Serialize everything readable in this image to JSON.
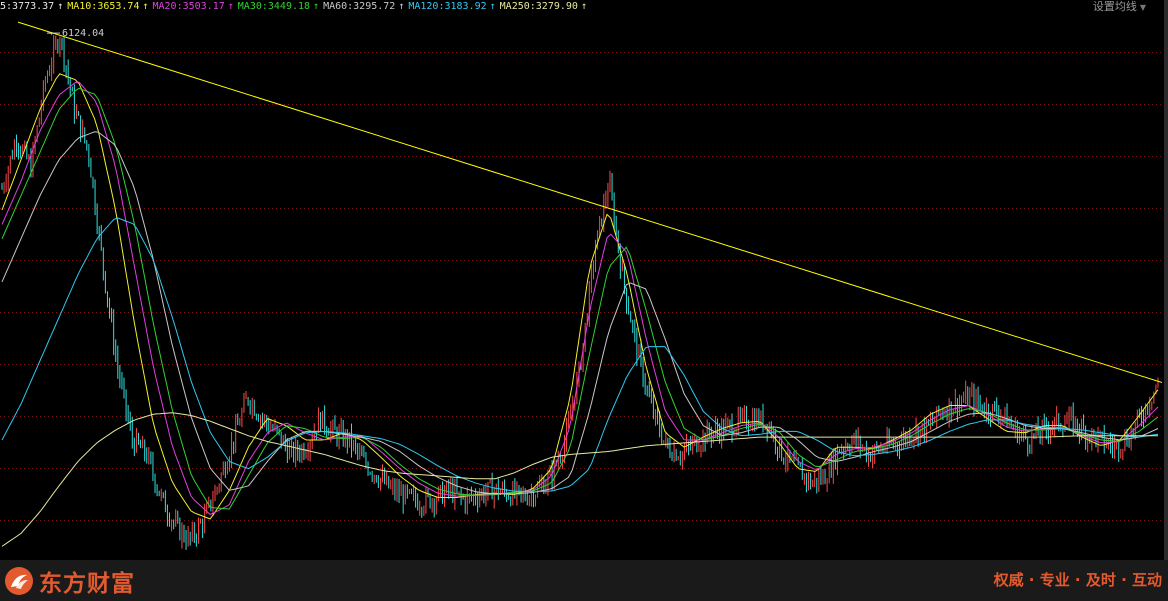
{
  "legend": [
    {
      "text": "5:3773.37",
      "color": "#e8e8e8"
    },
    {
      "text": "MA10:3653.74",
      "color": "#f2f22c"
    },
    {
      "text": "MA20:3503.17",
      "color": "#e040e0"
    },
    {
      "text": "MA30:3449.18",
      "color": "#32d232"
    },
    {
      "text": "MA60:3295.72",
      "color": "#c8c8c8"
    },
    {
      "text": "MA120:3183.92",
      "color": "#30c8f0"
    },
    {
      "text": "MA250:3279.90",
      "color": "#e8e8a0"
    }
  ],
  "legend_arrow": "↑",
  "settings_label": "设置均线",
  "footer": {
    "brand": "东方财富",
    "slogan": "权威 · 专业 · 及时 · 互动"
  },
  "colors": {
    "background": "#000000",
    "gridline": "#7a1515",
    "up_candle": "#ff4a4a",
    "down_candle": "#30e0e0",
    "trendline": "#ffff00",
    "brand": "#e45a2f"
  },
  "chart_data": {
    "type": "line",
    "subtype": "candlestick-with-moving-averages",
    "peak_label": "6124.04",
    "peak_value": 6124.04,
    "price_range": [
      2500,
      6250
    ],
    "grid": true,
    "gridlines": 10,
    "trendline": {
      "description": "descending resistance line through the two major peaks",
      "from_value": 6124.04,
      "to_value": 3700
    },
    "series": [
      {
        "name": "K",
        "path": [
          5050,
          5400,
          5200,
          5800,
          6124,
          5600,
          5300,
          4500,
          3800,
          3300,
          3200,
          2900,
          2700,
          2600,
          2750,
          3000,
          3300,
          3600,
          3450,
          3350,
          3200,
          3250,
          3450,
          3350,
          3300,
          3150,
          3050,
          2950,
          2900,
          2870,
          2900,
          2950,
          2880,
          2920,
          2960,
          2930,
          2900,
          2950,
          3050,
          3300,
          3800,
          4600,
          5100,
          4400,
          3900,
          3500,
          3250,
          3200,
          3280,
          3350,
          3380,
          3420,
          3450,
          3420,
          3200,
          3100,
          3000,
          3050,
          3250,
          3300,
          3200,
          3250,
          3280,
          3350,
          3380,
          3500,
          3550,
          3600,
          3520,
          3500,
          3380,
          3300,
          3360,
          3420,
          3430,
          3350,
          3300,
          3250,
          3320,
          3500,
          3700
        ]
      },
      {
        "name": "MA10",
        "color": "#f2f22c",
        "values": [
          3653.74
        ],
        "path": [
          4900,
          5250,
          5600,
          5850,
          5800,
          5500,
          4900,
          4100,
          3400,
          3000,
          2800,
          2750,
          2950,
          3250,
          3450,
          3400,
          3300,
          3300,
          3350,
          3300,
          3180,
          3050,
          2950,
          2900,
          2900,
          2920,
          2930,
          2920,
          2960,
          3100,
          3600,
          4500,
          4900,
          4450,
          3800,
          3350,
          3250,
          3320,
          3380,
          3420,
          3430,
          3280,
          3100,
          3080,
          3250,
          3250,
          3240,
          3300,
          3370,
          3480,
          3540,
          3540,
          3450,
          3360,
          3350,
          3400,
          3400,
          3320,
          3260,
          3300,
          3470,
          3650
        ]
      },
      {
        "name": "MA20",
        "color": "#e040e0",
        "values": [
          3503.17
        ],
        "path": [
          4800,
          5100,
          5450,
          5700,
          5800,
          5650,
          5200,
          4500,
          3800,
          3250,
          2900,
          2780,
          2850,
          3150,
          3350,
          3420,
          3350,
          3300,
          3320,
          3330,
          3220,
          3100,
          3000,
          2930,
          2910,
          2915,
          2925,
          2935,
          2950,
          3050,
          3400,
          4200,
          4750,
          4600,
          4000,
          3500,
          3300,
          3300,
          3350,
          3400,
          3420,
          3320,
          3150,
          3090,
          3200,
          3240,
          3250,
          3290,
          3350,
          3440,
          3510,
          3540,
          3480,
          3390,
          3360,
          3380,
          3390,
          3330,
          3280,
          3290,
          3400,
          3530
        ]
      },
      {
        "name": "MA30",
        "color": "#32d232",
        "values": [
          3449.18
        ],
        "path": [
          4700,
          5000,
          5300,
          5600,
          5750,
          5700,
          5350,
          4800,
          4100,
          3500,
          3050,
          2830,
          2820,
          3050,
          3280,
          3400,
          3380,
          3320,
          3310,
          3320,
          3250,
          3130,
          3030,
          2960,
          2925,
          2915,
          2920,
          2935,
          2945,
          3000,
          3250,
          3900,
          4500,
          4650,
          4200,
          3700,
          3380,
          3300,
          3330,
          3380,
          3410,
          3360,
          3200,
          3110,
          3160,
          3220,
          3240,
          3270,
          3330,
          3410,
          3480,
          3520,
          3490,
          3420,
          3370,
          3370,
          3380,
          3340,
          3300,
          3290,
          3360,
          3460
        ]
      },
      {
        "name": "MA60",
        "color": "#c8c8c8",
        "values": [
          3295.72
        ],
        "path": [
          4400,
          4700,
          5000,
          5250,
          5400,
          5450,
          5350,
          5050,
          4550,
          3950,
          3450,
          3100,
          2950,
          2980,
          3150,
          3300,
          3360,
          3360,
          3340,
          3320,
          3290,
          3220,
          3120,
          3040,
          2980,
          2940,
          2925,
          2925,
          2935,
          2960,
          3050,
          3500,
          4050,
          4400,
          4350,
          4000,
          3620,
          3400,
          3330,
          3350,
          3390,
          3390,
          3300,
          3180,
          3150,
          3180,
          3220,
          3250,
          3290,
          3360,
          3430,
          3480,
          3490,
          3450,
          3400,
          3380,
          3380,
          3350,
          3320,
          3300,
          3320,
          3380
        ]
      },
      {
        "name": "MA120",
        "color": "#30c8f0",
        "values": [
          3183.92
        ],
        "path": [
          3300,
          3550,
          3850,
          4150,
          4450,
          4700,
          4850,
          4800,
          4550,
          4150,
          3700,
          3350,
          3150,
          3100,
          3180,
          3290,
          3350,
          3360,
          3350,
          3330,
          3310,
          3270,
          3200,
          3120,
          3050,
          3000,
          2965,
          2945,
          2940,
          2945,
          2980,
          3100,
          3450,
          3750,
          3950,
          3950,
          3750,
          3500,
          3380,
          3330,
          3340,
          3360,
          3360,
          3300,
          3220,
          3190,
          3200,
          3220,
          3250,
          3300,
          3360,
          3410,
          3440,
          3440,
          3410,
          3390,
          3380,
          3370,
          3350,
          3330,
          3320,
          3340
        ]
      },
      {
        "name": "MA250",
        "color": "#e8e8a0",
        "values": [
          3279.9
        ],
        "path": [
          2560,
          2650,
          2800,
          2980,
          3150,
          3280,
          3370,
          3440,
          3480,
          3490,
          3470,
          3430,
          3380,
          3330,
          3290,
          3260,
          3230,
          3200,
          3160,
          3120,
          3090,
          3070,
          3060,
          3050,
          3040,
          3030,
          3030,
          3070,
          3130,
          3180,
          3200,
          3210,
          3220,
          3240,
          3260,
          3270,
          3280,
          3290,
          3300,
          3310,
          3320,
          3320,
          3320,
          3320,
          3320,
          3320,
          3320,
          3320,
          3320,
          3320,
          3320,
          3320,
          3320,
          3320,
          3320,
          3320,
          3325,
          3330,
          3330,
          3330,
          3330,
          3330
        ]
      }
    ]
  }
}
